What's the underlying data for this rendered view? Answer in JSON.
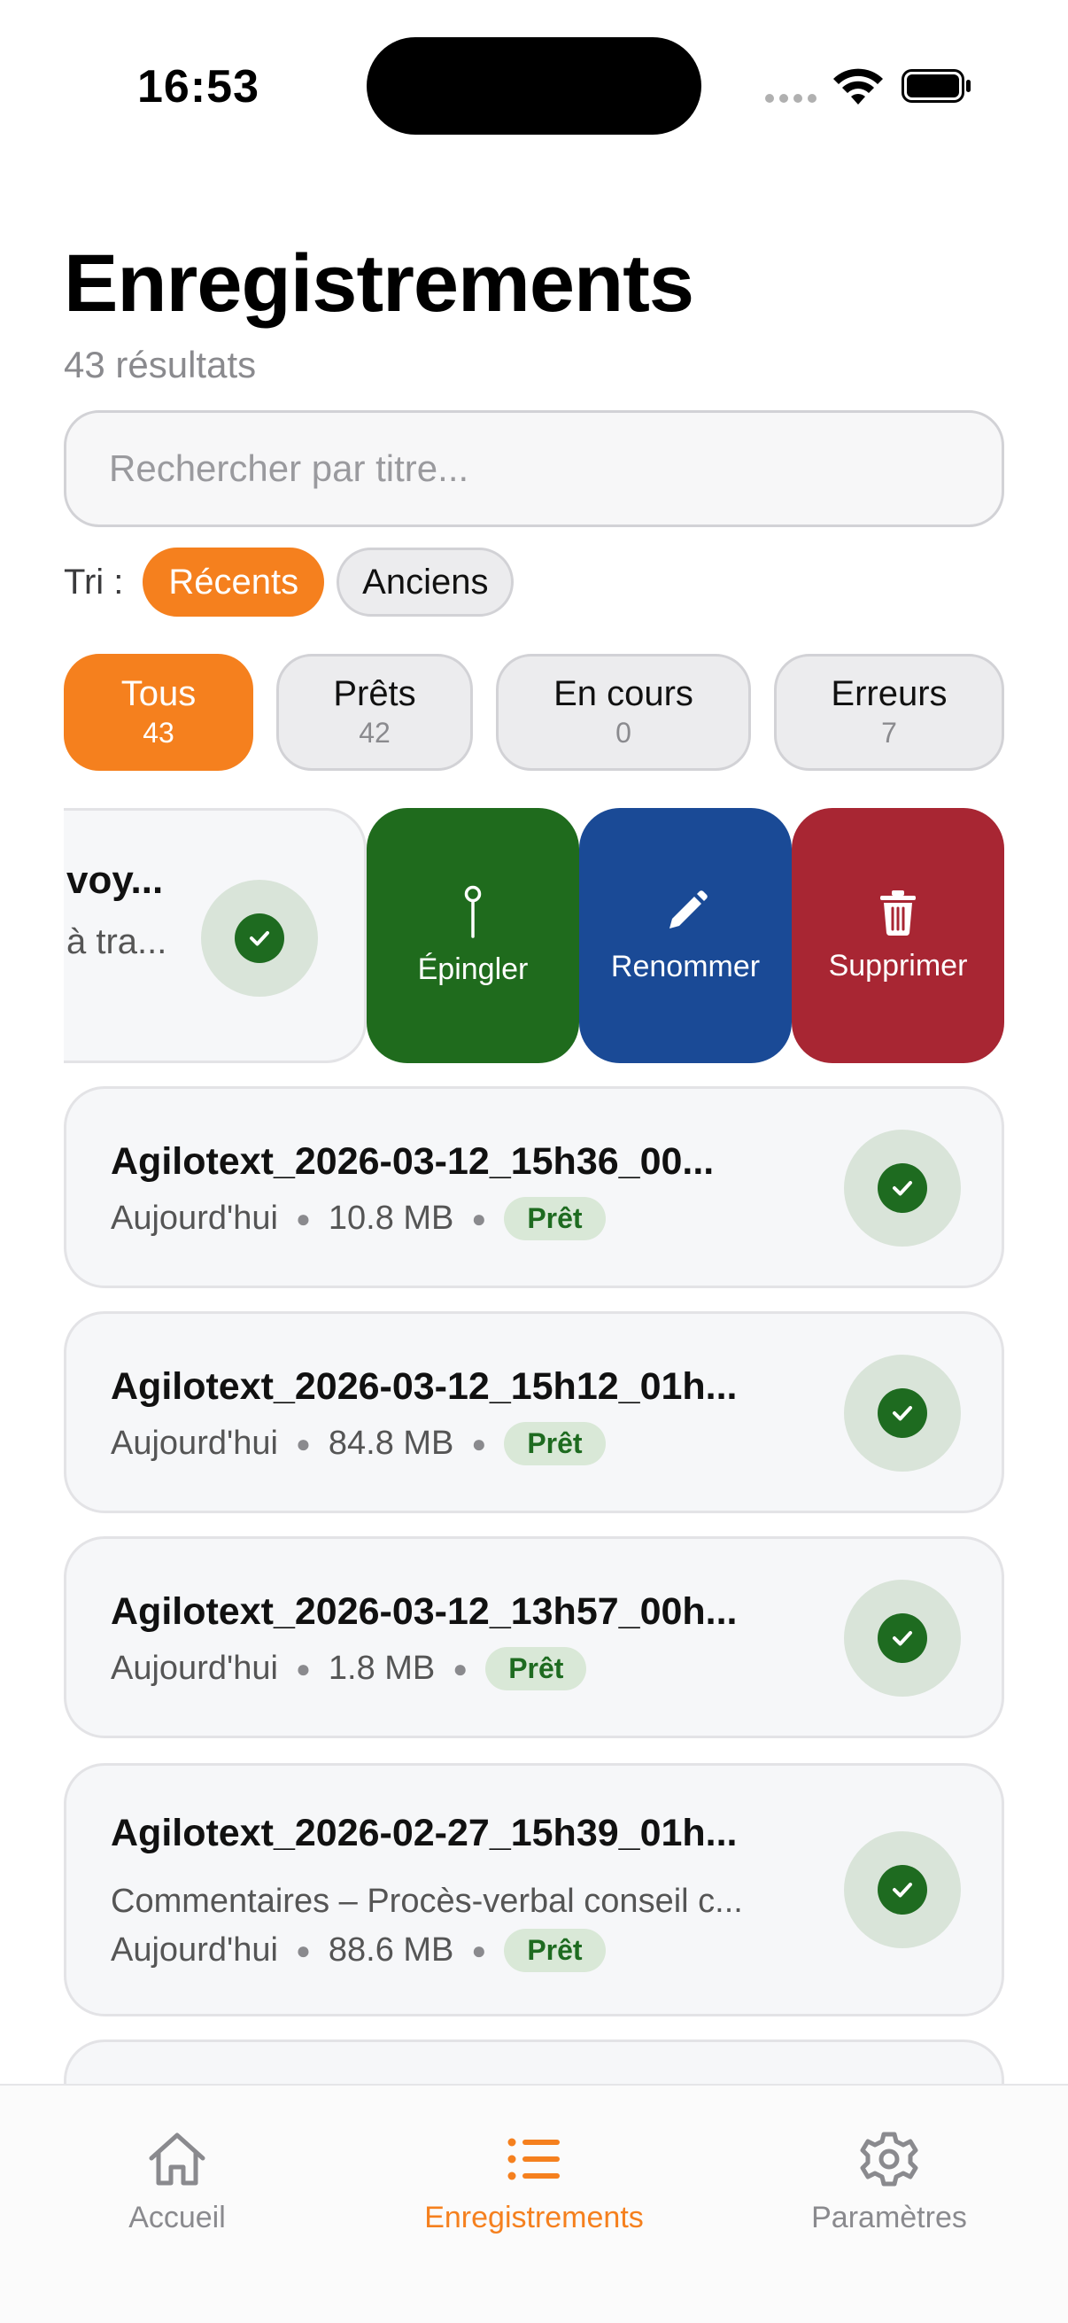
{
  "status_bar": {
    "time": "16:53"
  },
  "header": {
    "title": "Enregistrements",
    "count": "43 résultats"
  },
  "search": {
    "placeholder": "Rechercher par titre..."
  },
  "sort": {
    "label": "Tri :",
    "options": [
      "Récents",
      "Anciens"
    ],
    "selected": "Récents"
  },
  "filters": [
    {
      "label": "Tous",
      "count": "43"
    },
    {
      "label": "Prêts",
      "count": "42"
    },
    {
      "label": "En cours",
      "count": "0"
    },
    {
      "label": "Erreurs",
      "count": "7"
    }
  ],
  "swiped_item": {
    "title_fragment": "voy...",
    "subtitle_fragment": "à tra...",
    "actions": {
      "pin": "Épingler",
      "rename": "Renommer",
      "delete": "Supprimer"
    }
  },
  "recordings": [
    {
      "title": "Agilotext_2026-03-12_15h36_00...",
      "date": "Aujourd'hui",
      "size": "10.8 MB",
      "status": "Prêt"
    },
    {
      "title": "Agilotext_2026-03-12_15h12_01h...",
      "date": "Aujourd'hui",
      "size": "84.8 MB",
      "status": "Prêt"
    },
    {
      "title": "Agilotext_2026-03-12_13h57_00h...",
      "date": "Aujourd'hui",
      "size": "1.8 MB",
      "status": "Prêt"
    },
    {
      "title": "Agilotext_2026-02-27_15h39_01h...",
      "subtitle": "Commentaires – Procès-verbal conseil c...",
      "date": "Aujourd'hui",
      "size": "88.6 MB",
      "status": "Prêt"
    }
  ],
  "tabs": {
    "home": "Accueil",
    "records": "Enregistrements",
    "settings": "Paramètres"
  },
  "colors": {
    "accent": "#f5801e",
    "ready_green": "#1e6b20",
    "pin": "#1f6b1d",
    "rename": "#1a4a96",
    "delete": "#a82633"
  }
}
